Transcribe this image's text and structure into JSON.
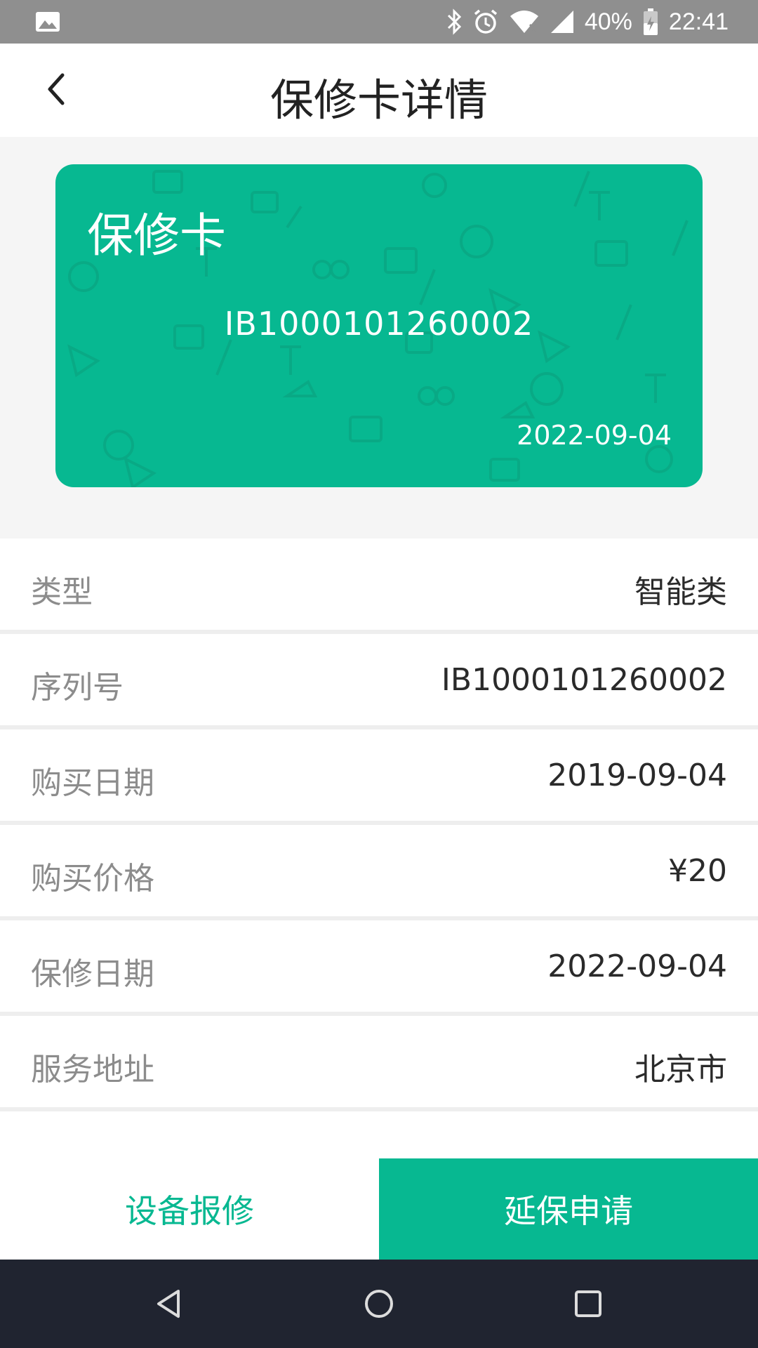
{
  "status_bar": {
    "battery": "40%",
    "time": "22:41",
    "icons": [
      "image-icon",
      "bluetooth-icon",
      "alarm-icon",
      "wifi-icon",
      "signal-icon",
      "battery-icon"
    ]
  },
  "header": {
    "title": "保修卡详情",
    "back_icon": "back-arrow-icon"
  },
  "card": {
    "title": "保修卡",
    "number": "IB1000101260002",
    "expiry_date": "2022-09-04",
    "color": "#07b891"
  },
  "details": [
    {
      "label": "类型",
      "value": "智能类"
    },
    {
      "label": "序列号",
      "value": "IB1000101260002"
    },
    {
      "label": "购买日期",
      "value": "2019-09-04"
    },
    {
      "label": "购买价格",
      "value": "¥20"
    },
    {
      "label": "保修日期",
      "value": "2022-09-04"
    },
    {
      "label": "服务地址",
      "value": "北京市"
    }
  ],
  "actions": {
    "repair_label": "设备报修",
    "extend_label": "延保申请"
  },
  "colors": {
    "accent": "#07b891",
    "status_bar": "#8f8f8f",
    "nav_bar": "#202430"
  },
  "nav_bar": {
    "icons": [
      "nav-back-icon",
      "nav-home-icon",
      "nav-recents-icon"
    ]
  }
}
